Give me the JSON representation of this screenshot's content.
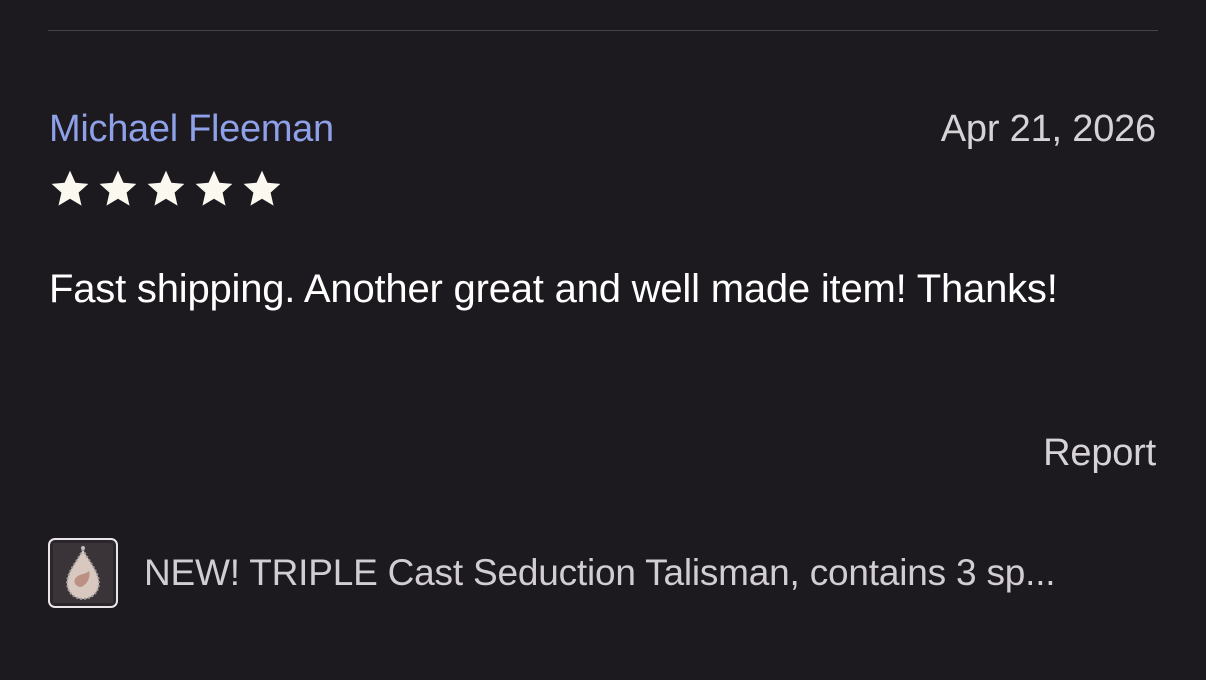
{
  "review": {
    "reviewer_name": "Michael Fleeman",
    "date": "Apr 21, 2026",
    "rating": 5,
    "rating_max": 5,
    "text": "Fast shipping. Another great and well made item! Thanks!",
    "report_label": "Report",
    "item": {
      "title": "NEW! TRIPLE Cast Seduction Talisman, contains 3 sp...",
      "thumbnail_icon": "pendant-thumbnail"
    }
  },
  "colors": {
    "background": "#1c1a1f",
    "reviewer_name": "#8ea0e8",
    "star": "#fbf8f0",
    "text": "#ffffff",
    "muted": "#d6d2d6",
    "divider": "#45404a"
  }
}
